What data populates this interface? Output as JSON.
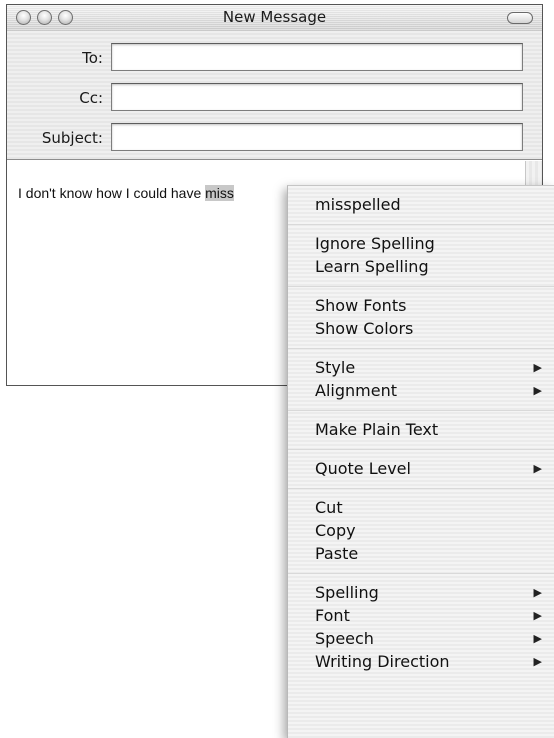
{
  "window": {
    "title": "New Message"
  },
  "header": {
    "to_label": "To:",
    "to_value": "",
    "cc_label": "Cc:",
    "cc_value": "",
    "subject_label": "Subject:",
    "subject_value": ""
  },
  "body": {
    "text_before": "I don't know how I could have ",
    "selected_text": "miss",
    "text_after": ""
  },
  "menu": {
    "groups": [
      [
        {
          "label": "misspelled",
          "submenu": false
        }
      ],
      [
        {
          "label": "Ignore Spelling",
          "submenu": false
        },
        {
          "label": "Learn Spelling",
          "submenu": false
        }
      ],
      [
        {
          "label": "Show Fonts",
          "submenu": false
        },
        {
          "label": "Show Colors",
          "submenu": false
        }
      ],
      [
        {
          "label": "Style",
          "submenu": true
        },
        {
          "label": "Alignment",
          "submenu": true
        }
      ],
      [
        {
          "label": "Make Plain Text",
          "submenu": false
        }
      ],
      [
        {
          "label": "Quote Level",
          "submenu": true
        }
      ],
      [
        {
          "label": "Cut",
          "submenu": false
        },
        {
          "label": "Copy",
          "submenu": false
        },
        {
          "label": "Paste",
          "submenu": false
        }
      ],
      [
        {
          "label": "Spelling",
          "submenu": true
        },
        {
          "label": "Font",
          "submenu": true
        },
        {
          "label": "Speech",
          "submenu": true
        },
        {
          "label": "Writing Direction",
          "submenu": true
        }
      ]
    ],
    "submenu_glyph": "▶"
  },
  "icons": {
    "close": "close-button",
    "minimize": "minimize-button",
    "zoom": "zoom-button",
    "toolbar": "toolbar-toggle"
  }
}
